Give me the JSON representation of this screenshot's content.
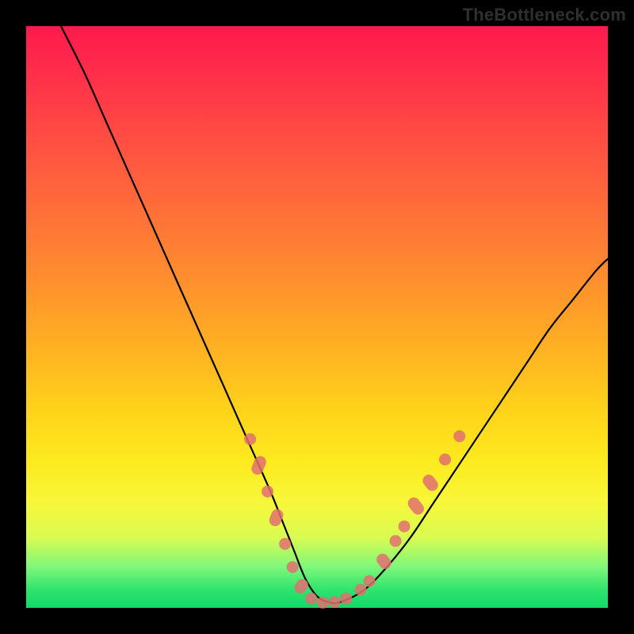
{
  "watermark": "TheBottleneck.com",
  "chart_data": {
    "type": "line",
    "title": "",
    "xlabel": "",
    "ylabel": "",
    "xlim": [
      0,
      100
    ],
    "ylim": [
      0,
      100
    ],
    "grid": false,
    "legend": false,
    "series": [
      {
        "name": "bottleneck-curve",
        "x": [
          6,
          10,
          14,
          18,
          22,
          26,
          30,
          34,
          38,
          42,
          44,
          46,
          48,
          50,
          52,
          54,
          58,
          62,
          66,
          70,
          74,
          78,
          82,
          86,
          90,
          94,
          98,
          100
        ],
        "y": [
          100,
          92,
          83,
          74,
          65,
          56,
          47,
          38,
          29,
          20,
          15,
          10,
          5,
          2,
          1,
          1,
          3,
          7,
          12,
          18,
          24,
          30,
          36,
          42,
          48,
          53,
          58,
          60
        ]
      }
    ],
    "markers": [
      {
        "kind": "dot",
        "x": 38.5,
        "y": 29.0
      },
      {
        "kind": "pill",
        "x": 40.0,
        "y": 24.5,
        "angle": -68,
        "len": 3.3
      },
      {
        "kind": "dot",
        "x": 41.5,
        "y": 20.0
      },
      {
        "kind": "pill",
        "x": 43.0,
        "y": 15.5,
        "angle": -68,
        "len": 3.0
      },
      {
        "kind": "dot",
        "x": 44.5,
        "y": 11.0
      },
      {
        "kind": "dot",
        "x": 45.8,
        "y": 7.0
      },
      {
        "kind": "pill",
        "x": 47.3,
        "y": 3.7,
        "angle": -55,
        "len": 2.6
      },
      {
        "kind": "dot",
        "x": 49.0,
        "y": 1.6
      },
      {
        "kind": "dot",
        "x": 51.0,
        "y": 0.9
      },
      {
        "kind": "dot",
        "x": 53.0,
        "y": 1.0
      },
      {
        "kind": "dot",
        "x": 55.0,
        "y": 1.6
      },
      {
        "kind": "dot",
        "x": 57.5,
        "y": 3.1
      },
      {
        "kind": "dot",
        "x": 59.0,
        "y": 4.6
      },
      {
        "kind": "pill",
        "x": 61.5,
        "y": 8.0,
        "angle": 52,
        "len": 2.8
      },
      {
        "kind": "dot",
        "x": 63.5,
        "y": 11.5
      },
      {
        "kind": "dot",
        "x": 65.0,
        "y": 14.0
      },
      {
        "kind": "pill",
        "x": 67.0,
        "y": 17.5,
        "angle": 52,
        "len": 3.2
      },
      {
        "kind": "pill",
        "x": 69.5,
        "y": 21.5,
        "angle": 52,
        "len": 3.0
      },
      {
        "kind": "dot",
        "x": 72.0,
        "y": 25.5
      },
      {
        "kind": "dot",
        "x": 74.5,
        "y": 29.5
      }
    ],
    "background_gradient": {
      "top": "#ff1a4d",
      "mid": "#ffd21a",
      "bottom": "#14d86a"
    }
  }
}
